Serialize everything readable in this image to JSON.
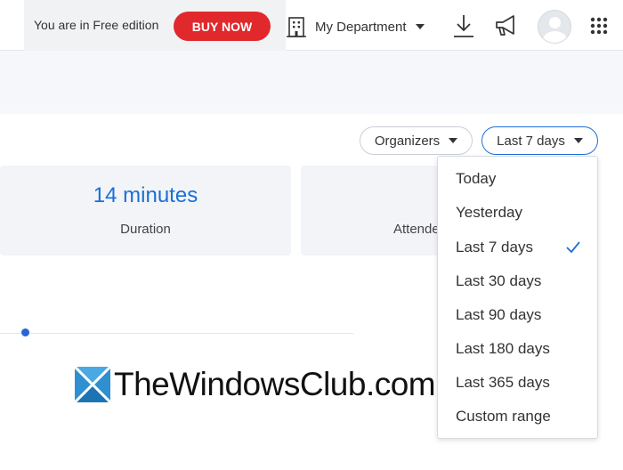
{
  "topbar": {
    "free_edition_text": "You are in Free edition",
    "buy_now_label": "BUY NOW",
    "department_label": "My Department",
    "icons": [
      "building-icon",
      "download-icon",
      "megaphone-icon",
      "avatar",
      "apps-grid-icon"
    ]
  },
  "filters": {
    "organizers_label": "Organizers",
    "period_label": "Last 7 days"
  },
  "stats": [
    {
      "value": "14 minutes",
      "label": "Duration"
    },
    {
      "value": "",
      "label": "Attende"
    }
  ],
  "period_menu": {
    "selected": "Last 7 days",
    "options": [
      "Today",
      "Yesterday",
      "Last 7 days",
      "Last 30 days",
      "Last 90 days",
      "Last 180 days",
      "Last 365 days",
      "Custom range"
    ]
  },
  "watermark": {
    "text": "TheWindowsClub.com"
  },
  "colors": {
    "buy_button": "#e1282c",
    "accent_blue": "#1a6fd6",
    "chart_point": "#2766d3"
  }
}
